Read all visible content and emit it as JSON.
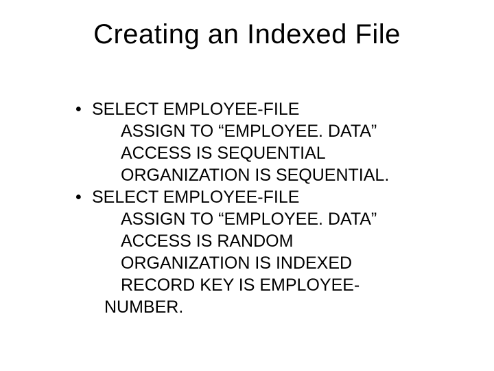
{
  "title": "Creating an Indexed File",
  "bullets": [
    {
      "head": "SELECT EMPLOYEE-FILE",
      "lines": [
        "ASSIGN TO “EMPLOYEE. DATA”",
        "ACCESS IS SEQUENTIAL",
        "ORGANIZATION IS SEQUENTIAL."
      ],
      "tail": ""
    },
    {
      "head": "SELECT EMPLOYEE-FILE",
      "lines": [
        "ASSIGN TO “EMPLOYEE. DATA”",
        "ACCESS IS RANDOM",
        "ORGANIZATION IS INDEXED",
        "RECORD KEY IS EMPLOYEE-"
      ],
      "tail": "NUMBER."
    }
  ]
}
